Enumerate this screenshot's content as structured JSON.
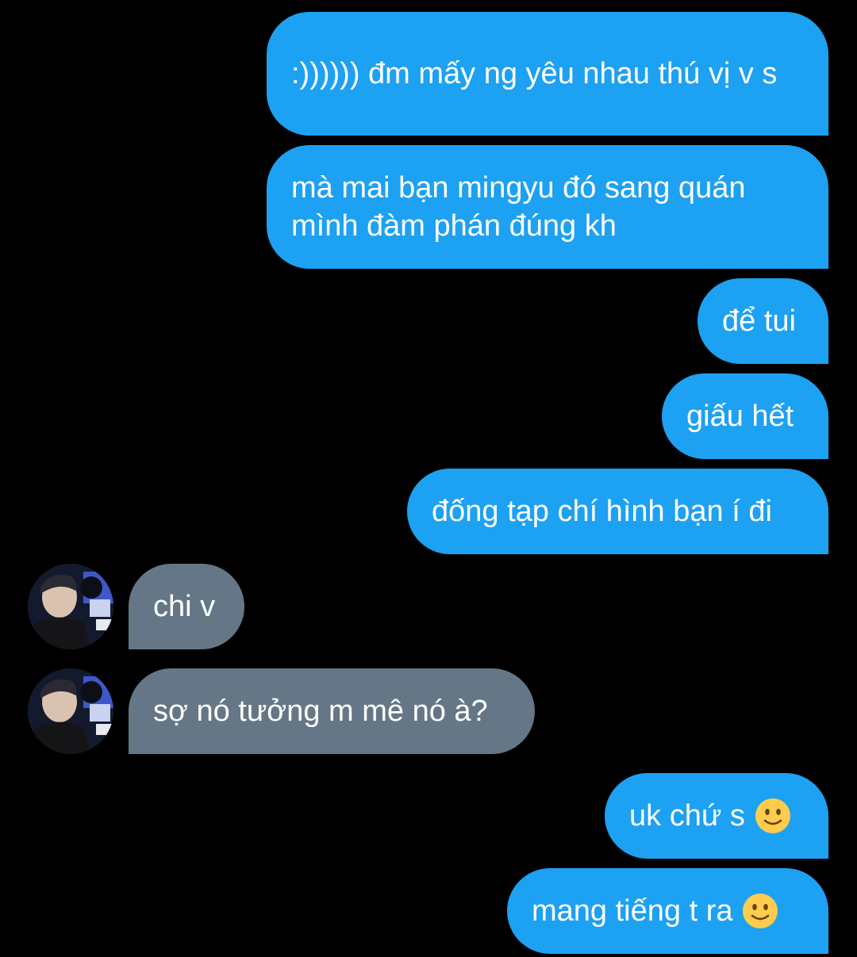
{
  "colors": {
    "background": "#000000",
    "outgoing_bubble": "#1da1f2",
    "incoming_bubble": "#657786",
    "text": "#ffffff"
  },
  "messages": [
    {
      "direction": "out",
      "text": ":)))))) đm mấy ng yêu nhau thú vị v s"
    },
    {
      "direction": "out",
      "text": "mà mai bạn mingyu đó sang quán mình đàm phán đúng kh"
    },
    {
      "direction": "out",
      "text": "để tui"
    },
    {
      "direction": "out",
      "text": "giấu hết"
    },
    {
      "direction": "out",
      "text": "đống tạp chí hình bạn í đi"
    },
    {
      "direction": "in",
      "text": "chi v",
      "avatar": "contact-avatar"
    },
    {
      "direction": "in",
      "text": "sợ nó tưởng m mê nó à?",
      "avatar": "contact-avatar"
    },
    {
      "direction": "out",
      "text": "uk chứ s",
      "emoji": "slightly-smiling-face-icon"
    },
    {
      "direction": "out",
      "text": "mang tiếng t ra",
      "emoji": "slightly-smiling-face-icon"
    }
  ]
}
